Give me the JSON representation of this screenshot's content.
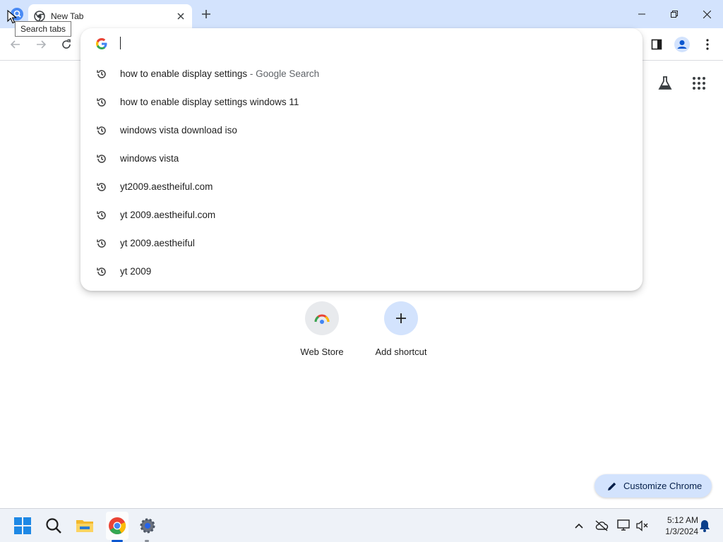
{
  "tooltip": "Search tabs",
  "tab": {
    "title": "New Tab"
  },
  "omnibox": {
    "value": "",
    "suggestions": [
      {
        "text": "how to enable display settings",
        "sep": " - ",
        "sub": "Google Search"
      },
      {
        "text": "how to enable display settings windows 11",
        "sep": "",
        "sub": ""
      },
      {
        "text": "windows vista download iso",
        "sep": "",
        "sub": ""
      },
      {
        "text": "windows vista",
        "sep": "",
        "sub": ""
      },
      {
        "text": "yt2009.aestheiful.com",
        "sep": "",
        "sub": ""
      },
      {
        "text": "yt 2009.aestheiful.com",
        "sep": "",
        "sub": ""
      },
      {
        "text": "yt 2009.aestheiful",
        "sep": "",
        "sub": ""
      },
      {
        "text": "yt 2009",
        "sep": "",
        "sub": ""
      }
    ]
  },
  "shortcuts": [
    {
      "label": "Web Store"
    },
    {
      "label": "Add shortcut"
    }
  ],
  "customize": {
    "label": "Customize Chrome"
  },
  "clock": {
    "time": "5:12 AM",
    "date": "1/3/2024"
  },
  "colors": {
    "tabstrip": "#d3e3fd",
    "accent": "#0b57d0",
    "taskbar": "#eef2f8"
  }
}
